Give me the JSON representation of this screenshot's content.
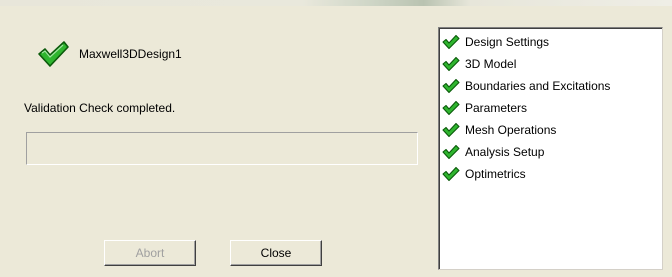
{
  "design": {
    "name": "Maxwell3DDesign1",
    "status_icon": "green-check-icon"
  },
  "status_message": "Validation Check completed.",
  "progress": {
    "fraction": 0.0
  },
  "buttons": {
    "abort_label": "Abort",
    "abort_enabled": false,
    "close_label": "Close"
  },
  "steps": [
    {
      "label": "Design Settings",
      "status_icon": "green-check-icon"
    },
    {
      "label": "3D Model",
      "status_icon": "green-check-icon"
    },
    {
      "label": "Boundaries and Excitations",
      "status_icon": "green-check-icon"
    },
    {
      "label": "Parameters",
      "status_icon": "green-check-icon"
    },
    {
      "label": "Mesh Operations",
      "status_icon": "green-check-icon"
    },
    {
      "label": "Analysis Setup",
      "status_icon": "green-check-icon"
    },
    {
      "label": "Optimetrics",
      "status_icon": "green-check-icon"
    }
  ],
  "colors": {
    "check_fill": "#2fb52f",
    "check_outline": "#0b5a0b",
    "dialog_background": "#ece9d8",
    "disabled_text": "#a0a0a0"
  }
}
